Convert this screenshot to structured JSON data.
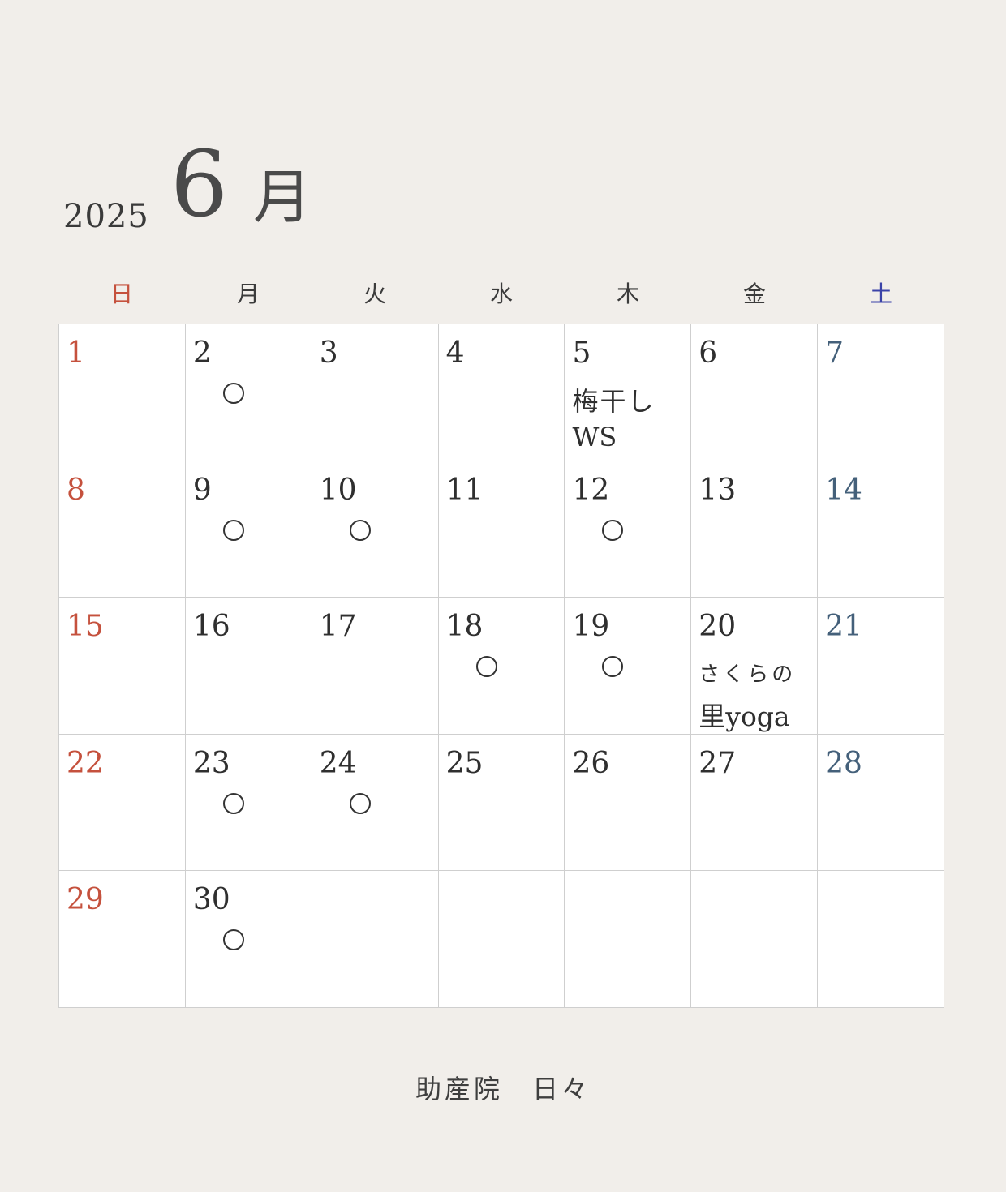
{
  "header": {
    "year": "2025",
    "month_number": "6",
    "month_kanji": "月"
  },
  "weekdays": [
    "日",
    "月",
    "火",
    "水",
    "木",
    "金",
    "土"
  ],
  "weeks": [
    [
      {
        "day": "1"
      },
      {
        "day": "2",
        "mark": true
      },
      {
        "day": "3"
      },
      {
        "day": "4"
      },
      {
        "day": "5",
        "event_line1": "梅干し",
        "event_line2": "WS"
      },
      {
        "day": "6"
      },
      {
        "day": "7"
      }
    ],
    [
      {
        "day": "8"
      },
      {
        "day": "9",
        "mark": true
      },
      {
        "day": "10",
        "mark": true
      },
      {
        "day": "11"
      },
      {
        "day": "12",
        "mark": true
      },
      {
        "day": "13"
      },
      {
        "day": "14"
      }
    ],
    [
      {
        "day": "15"
      },
      {
        "day": "16"
      },
      {
        "day": "17"
      },
      {
        "day": "18",
        "mark": true
      },
      {
        "day": "19",
        "mark": true
      },
      {
        "day": "20",
        "event_line1": "さくらの",
        "event_line2": "里yoga"
      },
      {
        "day": "21"
      }
    ],
    [
      {
        "day": "22"
      },
      {
        "day": "23",
        "mark": true
      },
      {
        "day": "24",
        "mark": true
      },
      {
        "day": "25"
      },
      {
        "day": "26"
      },
      {
        "day": "27"
      },
      {
        "day": "28"
      }
    ],
    [
      {
        "day": "29"
      },
      {
        "day": "30",
        "mark": true
      },
      {
        "day": ""
      },
      {
        "day": ""
      },
      {
        "day": ""
      },
      {
        "day": ""
      },
      {
        "day": ""
      }
    ]
  ],
  "colors": {
    "sunday": "#c5513d",
    "saturday_header": "#3b43a8",
    "saturday_date": "#44607a",
    "background": "#f1eeea",
    "grid_line": "#cfcfcf"
  },
  "mark_icon": "circle-icon",
  "footer": "助産院　日々"
}
